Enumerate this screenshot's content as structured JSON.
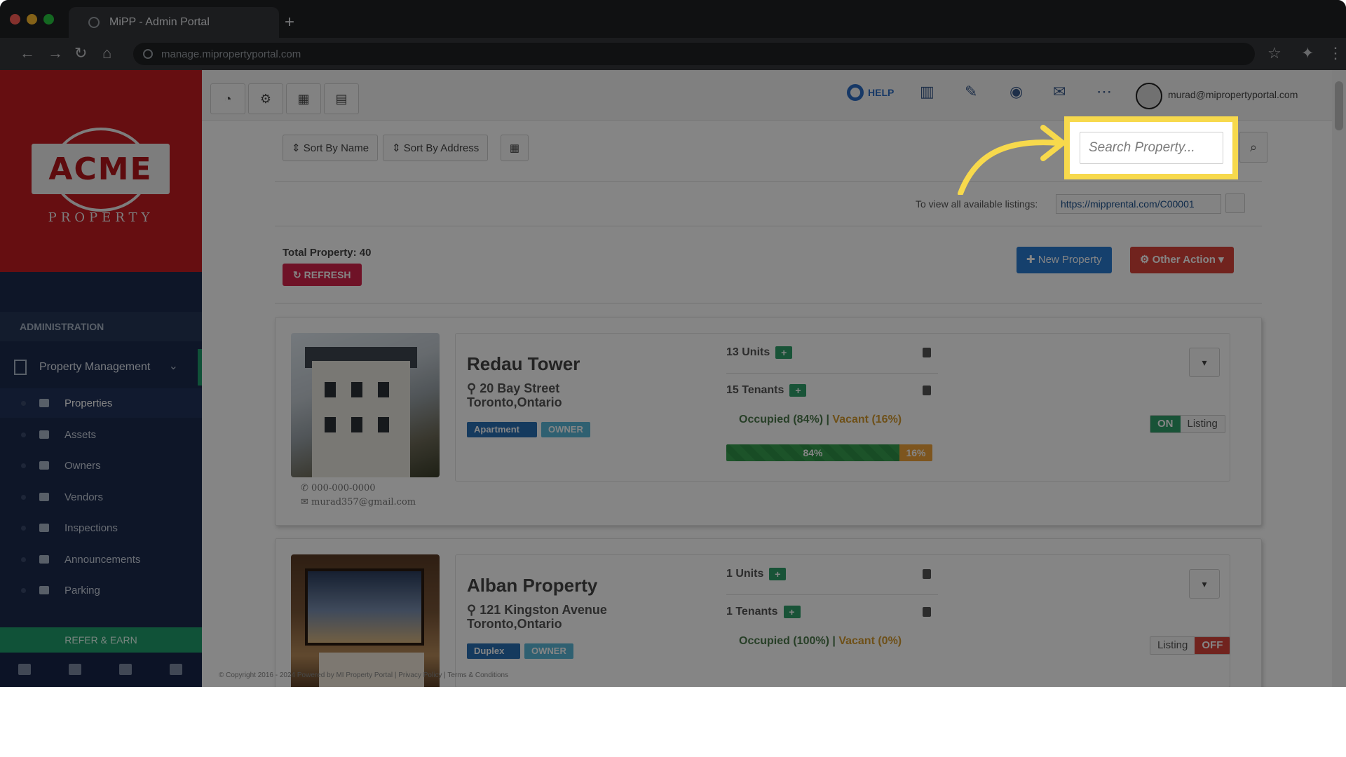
{
  "browser": {
    "tab_title": "MiPP - Admin Portal",
    "url": "manage.mipropertyportal.com"
  },
  "logo": {
    "name": "ACME",
    "sub": "PROPERTY"
  },
  "sidebar": {
    "section_header": "ADMINISTRATION",
    "group_label": "Property Management",
    "items": [
      {
        "label": "Properties",
        "icon": "home-icon"
      },
      {
        "label": "Assets",
        "icon": "box-icon"
      },
      {
        "label": "Owners",
        "icon": "user-icon"
      },
      {
        "label": "Vendors",
        "icon": "briefcase-icon"
      },
      {
        "label": "Inspections",
        "icon": "search-plus-icon"
      },
      {
        "label": "Announcements",
        "icon": "bullhorn-icon"
      },
      {
        "label": "Parking",
        "icon": "car-icon"
      }
    ],
    "refer_label": "REFER & EARN"
  },
  "topnav": {
    "help_label": "HELP",
    "user_email": "murad@mipropertyportal.com"
  },
  "controls": {
    "sort_name": "Sort By Name",
    "sort_address": "Sort By Address",
    "search_placeholder": "Search Property...",
    "listing_note": "To view all available listings:",
    "listing_url": "https://mipprental.com/C00001",
    "total_label": "Total Property: 40",
    "refresh_label": "REFRESH",
    "new_property_label": "New Property",
    "other_action_label": "Other Action"
  },
  "properties": [
    {
      "name": "Redau Tower",
      "address_line1": "20 Bay Street",
      "address_line2": "Toronto,Ontario",
      "type_tag": "Apartment",
      "owner_tag": "OWNER",
      "phone": "000-000-0000",
      "email": "murad357@gmail.com",
      "units": "13 Units",
      "tenants": "15 Tenants",
      "occupied_label": "Occupied (84%)",
      "vacant_label": "Vacant (16%)",
      "occupied_pct": 84,
      "occupied_text": "84%",
      "vacant_text": "16%",
      "toggle_state": "ON",
      "toggle_label": "Listing"
    },
    {
      "name": "Alban Property",
      "address_line1": "121 Kingston Avenue",
      "address_line2": "Toronto,Ontario",
      "type_tag": "Duplex",
      "owner_tag": "OWNER",
      "units": "1 Units",
      "tenants": "1 Tenants",
      "occupied_label": "Occupied (100%)",
      "vacant_label": "Vacant (0%)",
      "toggle_state": "OFF",
      "toggle_label": "Listing"
    }
  ],
  "footer": {
    "copyright": "© Copyright 2016 - 2024 Powered by MI Property Portal | Privacy Policy | Terms & Conditions"
  },
  "colors": {
    "brand_red": "#c41b22",
    "sidebar_navy": "#1c2b4e",
    "accent_green": "#1f9e6b",
    "highlight_yellow": "#f7d94c"
  }
}
